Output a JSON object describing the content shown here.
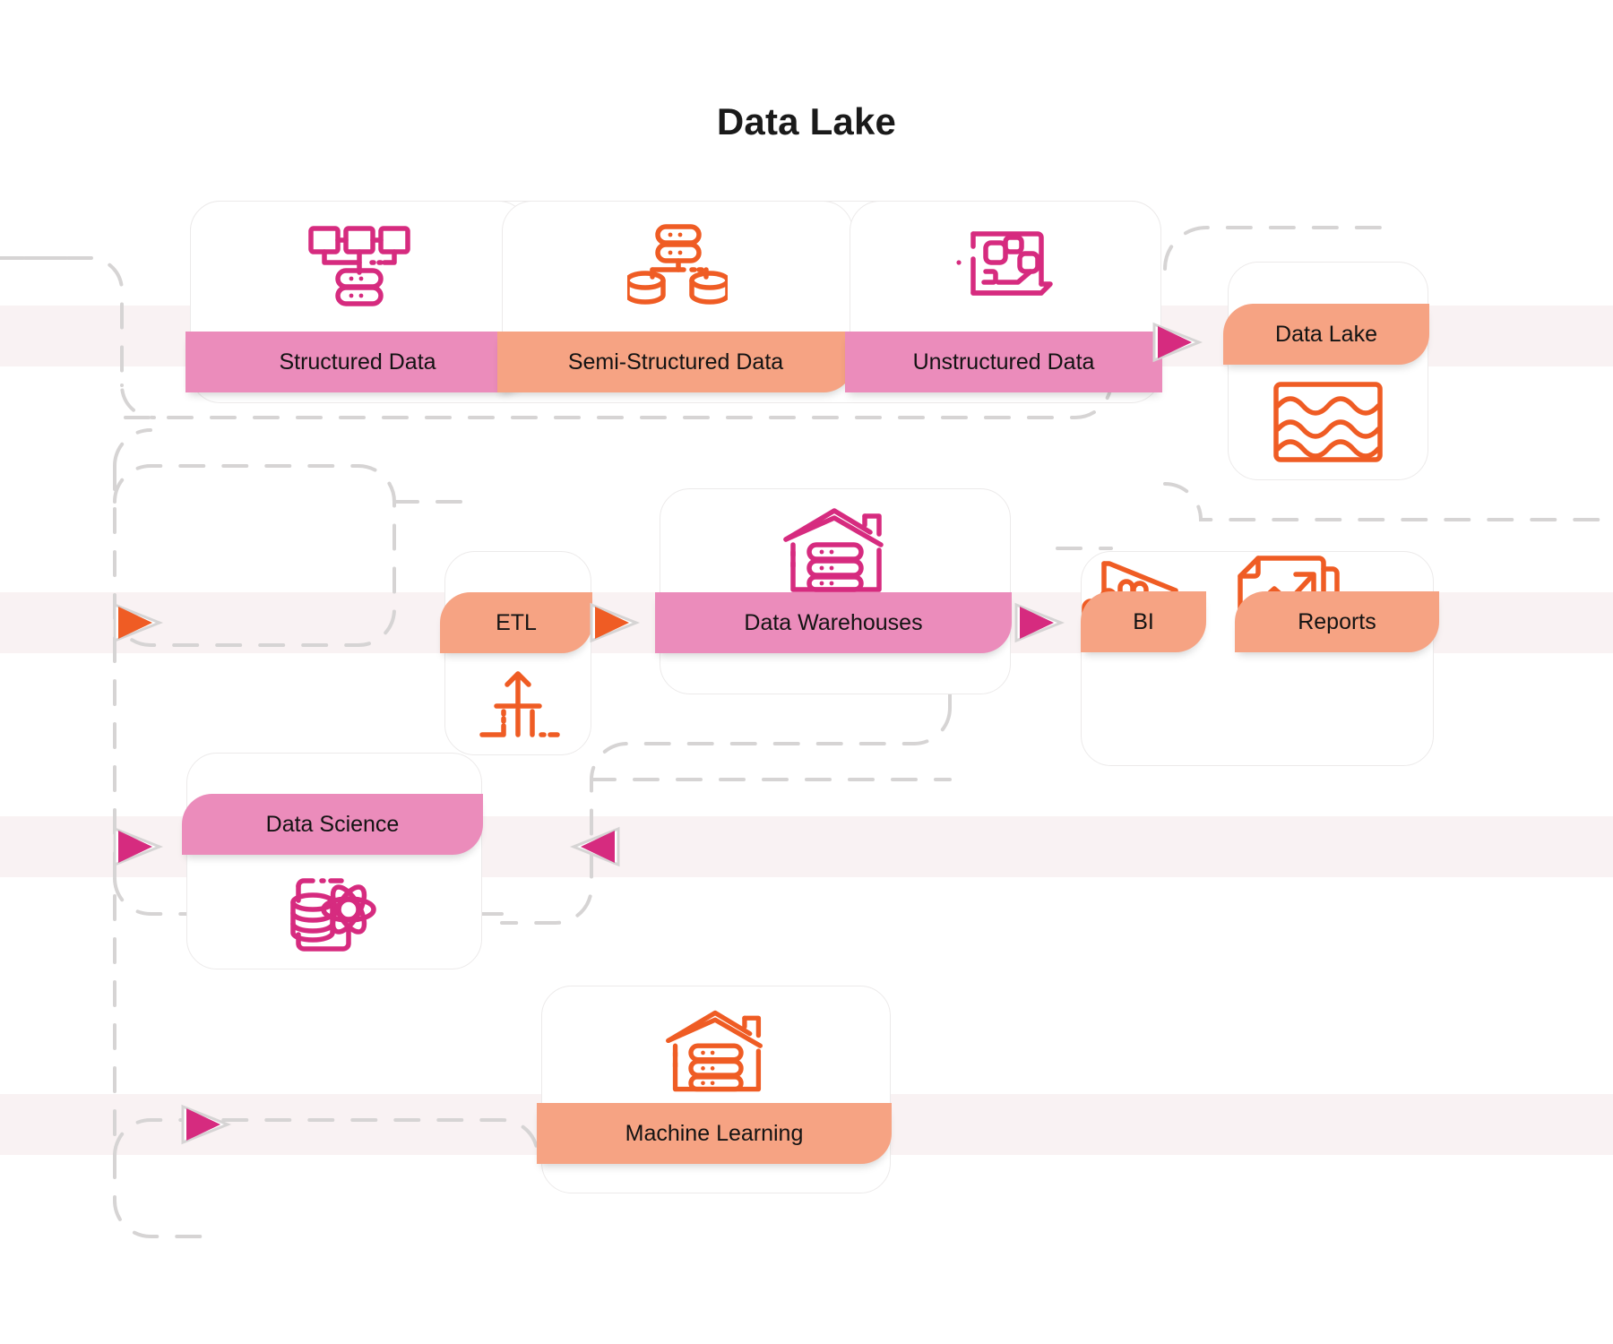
{
  "title": "Data Lake",
  "colors": {
    "magenta": "#d62b7f",
    "orange": "#ef5c24",
    "pink_band": "#eb8cbb",
    "salmon_band": "#f6a383",
    "row_band": "#f9f2f3",
    "connector": "#d6d4d4",
    "card_border": "#eceaea",
    "text": "#131313"
  },
  "cards": {
    "structured": {
      "label": "Structured Data",
      "icon": "hierarchy-database-icon",
      "icon_color": "#d62b7f",
      "band_color": "pink"
    },
    "semi_structured": {
      "label": "Semi-Structured Data",
      "icon": "server-two-databases-icon",
      "icon_color": "#ef5c24",
      "band_color": "salmon"
    },
    "unstructured": {
      "label": "Unstructured Data",
      "icon": "laptop-media-icon",
      "icon_color": "#d62b7f",
      "band_color": "pink"
    },
    "data_lake": {
      "label": "Data Lake",
      "icon": "waves-lake-icon",
      "icon_color": "#ef5c24",
      "band_color": "salmon"
    },
    "etl": {
      "label": "ETL",
      "icon": "etl-arrow-merge-icon",
      "icon_color": "#ef5c24",
      "band_color": "salmon"
    },
    "data_warehouses": {
      "label": "Data Warehouses",
      "icon": "warehouse-server-icon",
      "icon_color": "#d62b7f",
      "band_color": "pink"
    },
    "bi": {
      "label": "BI",
      "icon": "bi-bars-icon",
      "icon_color": "#ef5c24",
      "band_color": "salmon"
    },
    "reports": {
      "label": "Reports",
      "icon": "report-trend-icon",
      "icon_color": "#ef5c24",
      "band_color": "salmon"
    },
    "data_science": {
      "label": "Data Science",
      "icon": "database-atom-icon",
      "icon_color": "#d62b7f",
      "band_color": "pink"
    },
    "machine_learning": {
      "label": "Machine Learning",
      "icon": "warehouse-server-icon",
      "icon_color": "#ef5c24",
      "band_color": "salmon"
    }
  },
  "arrows": [
    {
      "name": "arrow-unstructured-to-data-lake",
      "color": "#d62b7f",
      "direction": "right"
    },
    {
      "name": "arrow-into-etl-row",
      "color": "#ef5c24",
      "direction": "right"
    },
    {
      "name": "arrow-etl-to-warehouses",
      "color": "#ef5c24",
      "direction": "right"
    },
    {
      "name": "arrow-warehouses-to-bi",
      "color": "#d62b7f",
      "direction": "right"
    },
    {
      "name": "arrow-into-data-science",
      "color": "#d62b7f",
      "direction": "right"
    },
    {
      "name": "arrow-out-of-data-science-row",
      "color": "#d62b7f",
      "direction": "left"
    },
    {
      "name": "arrow-into-machine-learning",
      "color": "#d62b7f",
      "direction": "right"
    }
  ]
}
